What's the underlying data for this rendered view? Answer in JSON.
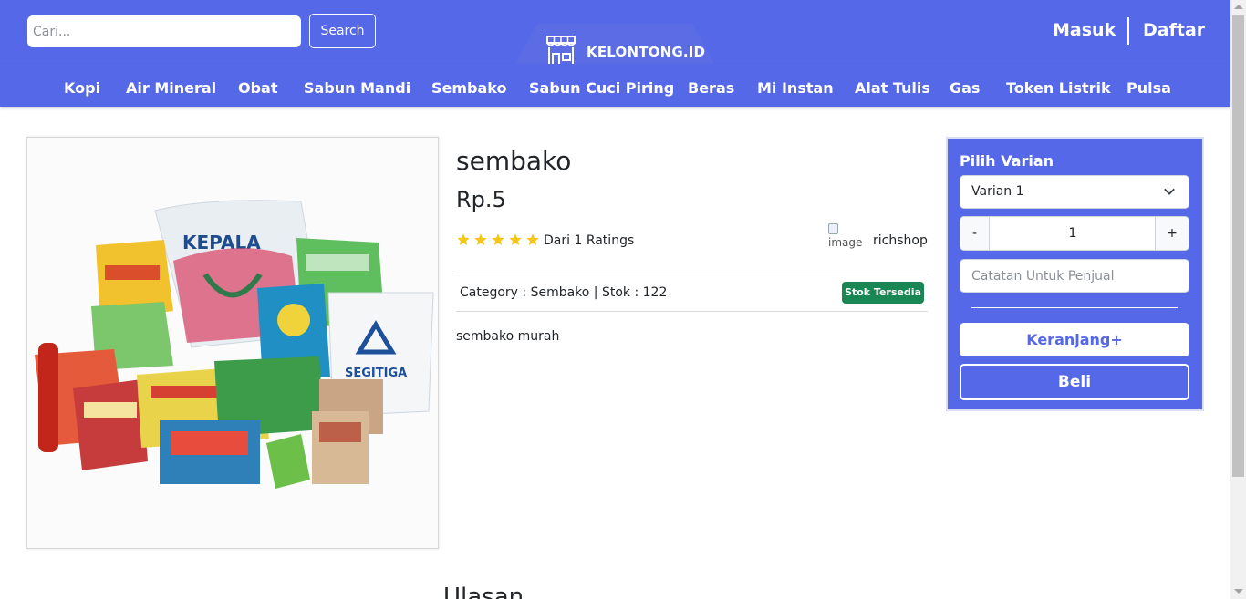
{
  "header": {
    "search": {
      "placeholder": "Cari...",
      "value": ""
    },
    "search_button": "Search",
    "logo_text": "KELONTONG.ID",
    "logo_icon": "storefront-icon",
    "auth": {
      "login": "Masuk",
      "register": "Daftar"
    }
  },
  "categories": [
    "Kopi",
    "Air Mineral",
    "Obat",
    "Sabun Mandi",
    "Sembako",
    "Sabun Cuci Piring",
    "Beras",
    "Mi Instan",
    "Alat Tulis",
    "Gas",
    "Token Listrik",
    "Pulsa"
  ],
  "product": {
    "name": "sembako",
    "price": "Rp.5",
    "rating_stars": 5,
    "ratings_text": "Dari 1 Ratings",
    "seller_image_alt": "image",
    "seller_name": "richshop",
    "category_line": "Category : Sembako | Stok : 122",
    "stock_badge": "Stok Tersedia",
    "description": "sembako murah",
    "image_content": [
      "KEPALA",
      "SEGITIGA"
    ]
  },
  "purchase_panel": {
    "title": "Pilih Varian",
    "variant_selected": "Varian 1",
    "quantity_minus": "-",
    "quantity_value": "1",
    "quantity_plus": "+",
    "note_placeholder": "Catatan Untuk Penjual",
    "cart_button": "Keranjang+",
    "buy_button": "Beli"
  },
  "reviews": {
    "heading": "Ulasan"
  },
  "colors": {
    "primary": "#5468e8",
    "badge_green": "#198754",
    "star": "#f5c518"
  }
}
